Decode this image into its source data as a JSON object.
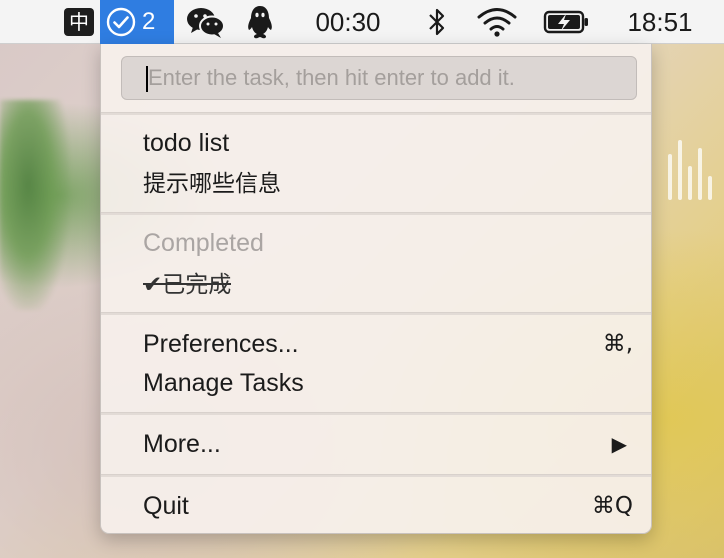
{
  "menubar": {
    "ime_label": "中",
    "todo_count": "2",
    "clock_timer": "00:30",
    "clock_time": "18:51",
    "icons": [
      "ime-icon",
      "todo-check-icon",
      "wechat-icon",
      "qq-penguin-icon",
      "bluetooth-icon",
      "wifi-icon",
      "battery-charging-icon"
    ]
  },
  "menu": {
    "input": {
      "placeholder": "Enter the task, then hit enter to add it.",
      "value": ""
    },
    "todo_header": "todo list",
    "todo_items": [
      "提示哪些信息"
    ],
    "completed_header": "Completed",
    "completed_items": [
      {
        "check": "✔",
        "text": "已完成"
      }
    ],
    "preferences_label": "Preferences...",
    "preferences_shortcut": "⌘,",
    "manage_tasks_label": "Manage Tasks",
    "more_label": "More...",
    "more_arrow": "▶",
    "quit_label": "Quit",
    "quit_shortcut": "⌘Q"
  },
  "colors": {
    "menubar_bg": "#f4f4f4",
    "active_status_item": "#2f7de1",
    "menu_bg": "#f6f0ec",
    "disabled_text": "#aaa5a3"
  }
}
